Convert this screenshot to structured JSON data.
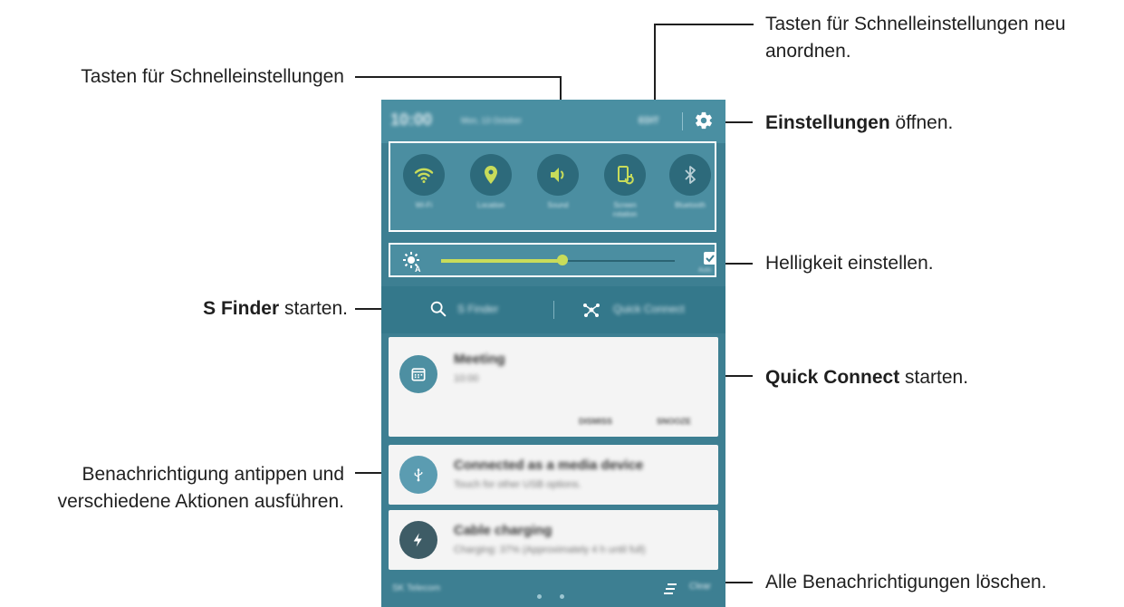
{
  "callouts": {
    "qs_rearrange_line1": "Tasten für Schnelleinstellungen neu",
    "qs_rearrange_line2": "anordnen.",
    "qs_buttons": "Tasten für Schnelleinstellungen",
    "settings_bold": "Einstellungen",
    "settings_rest": " öffnen.",
    "brightness": "Helligkeit einstellen.",
    "sfinder_bold": "S Finder",
    "sfinder_rest": " starten.",
    "qc_bold": "Quick Connect",
    "qc_rest": " starten.",
    "notif_line1": "Benachrichtigung antippen und",
    "notif_line2": "verschiedene Aktionen ausführen.",
    "clear_all": "Alle Benachrichtigungen löschen."
  },
  "phone": {
    "status": {
      "time": "10:00",
      "date": "Mon, 13 October",
      "edit": "EDIT"
    },
    "quick_settings": [
      {
        "label": "Wi-Fi",
        "icon": "wifi-icon"
      },
      {
        "label": "Location",
        "icon": "location-icon"
      },
      {
        "label": "Sound",
        "icon": "sound-icon"
      },
      {
        "label": "Screen rotation",
        "icon": "screen-rotation-icon"
      },
      {
        "label": "Bluetooth",
        "icon": "bluetooth-icon"
      }
    ],
    "brightness": {
      "level": 0.52,
      "auto_label": "Auto"
    },
    "finder": {
      "sfinder": "S Finder",
      "quick_connect": "Quick Connect"
    },
    "notifications": [
      {
        "title": "Meeting",
        "sub": "10:00",
        "actions": [
          "DISMISS",
          "SNOOZE"
        ]
      },
      {
        "title": "Connected as a media device",
        "sub": "Touch for other USB options."
      },
      {
        "title": "Cable charging",
        "sub": "Charging: 37% (Approximately 4 h until full)"
      }
    ],
    "footer": {
      "carrier": "SK Telecom",
      "clear": "Clear"
    },
    "colors": {
      "panel": "#3d7f92",
      "accent": "#c8dc5a",
      "circle": "#2d6a7b"
    }
  }
}
